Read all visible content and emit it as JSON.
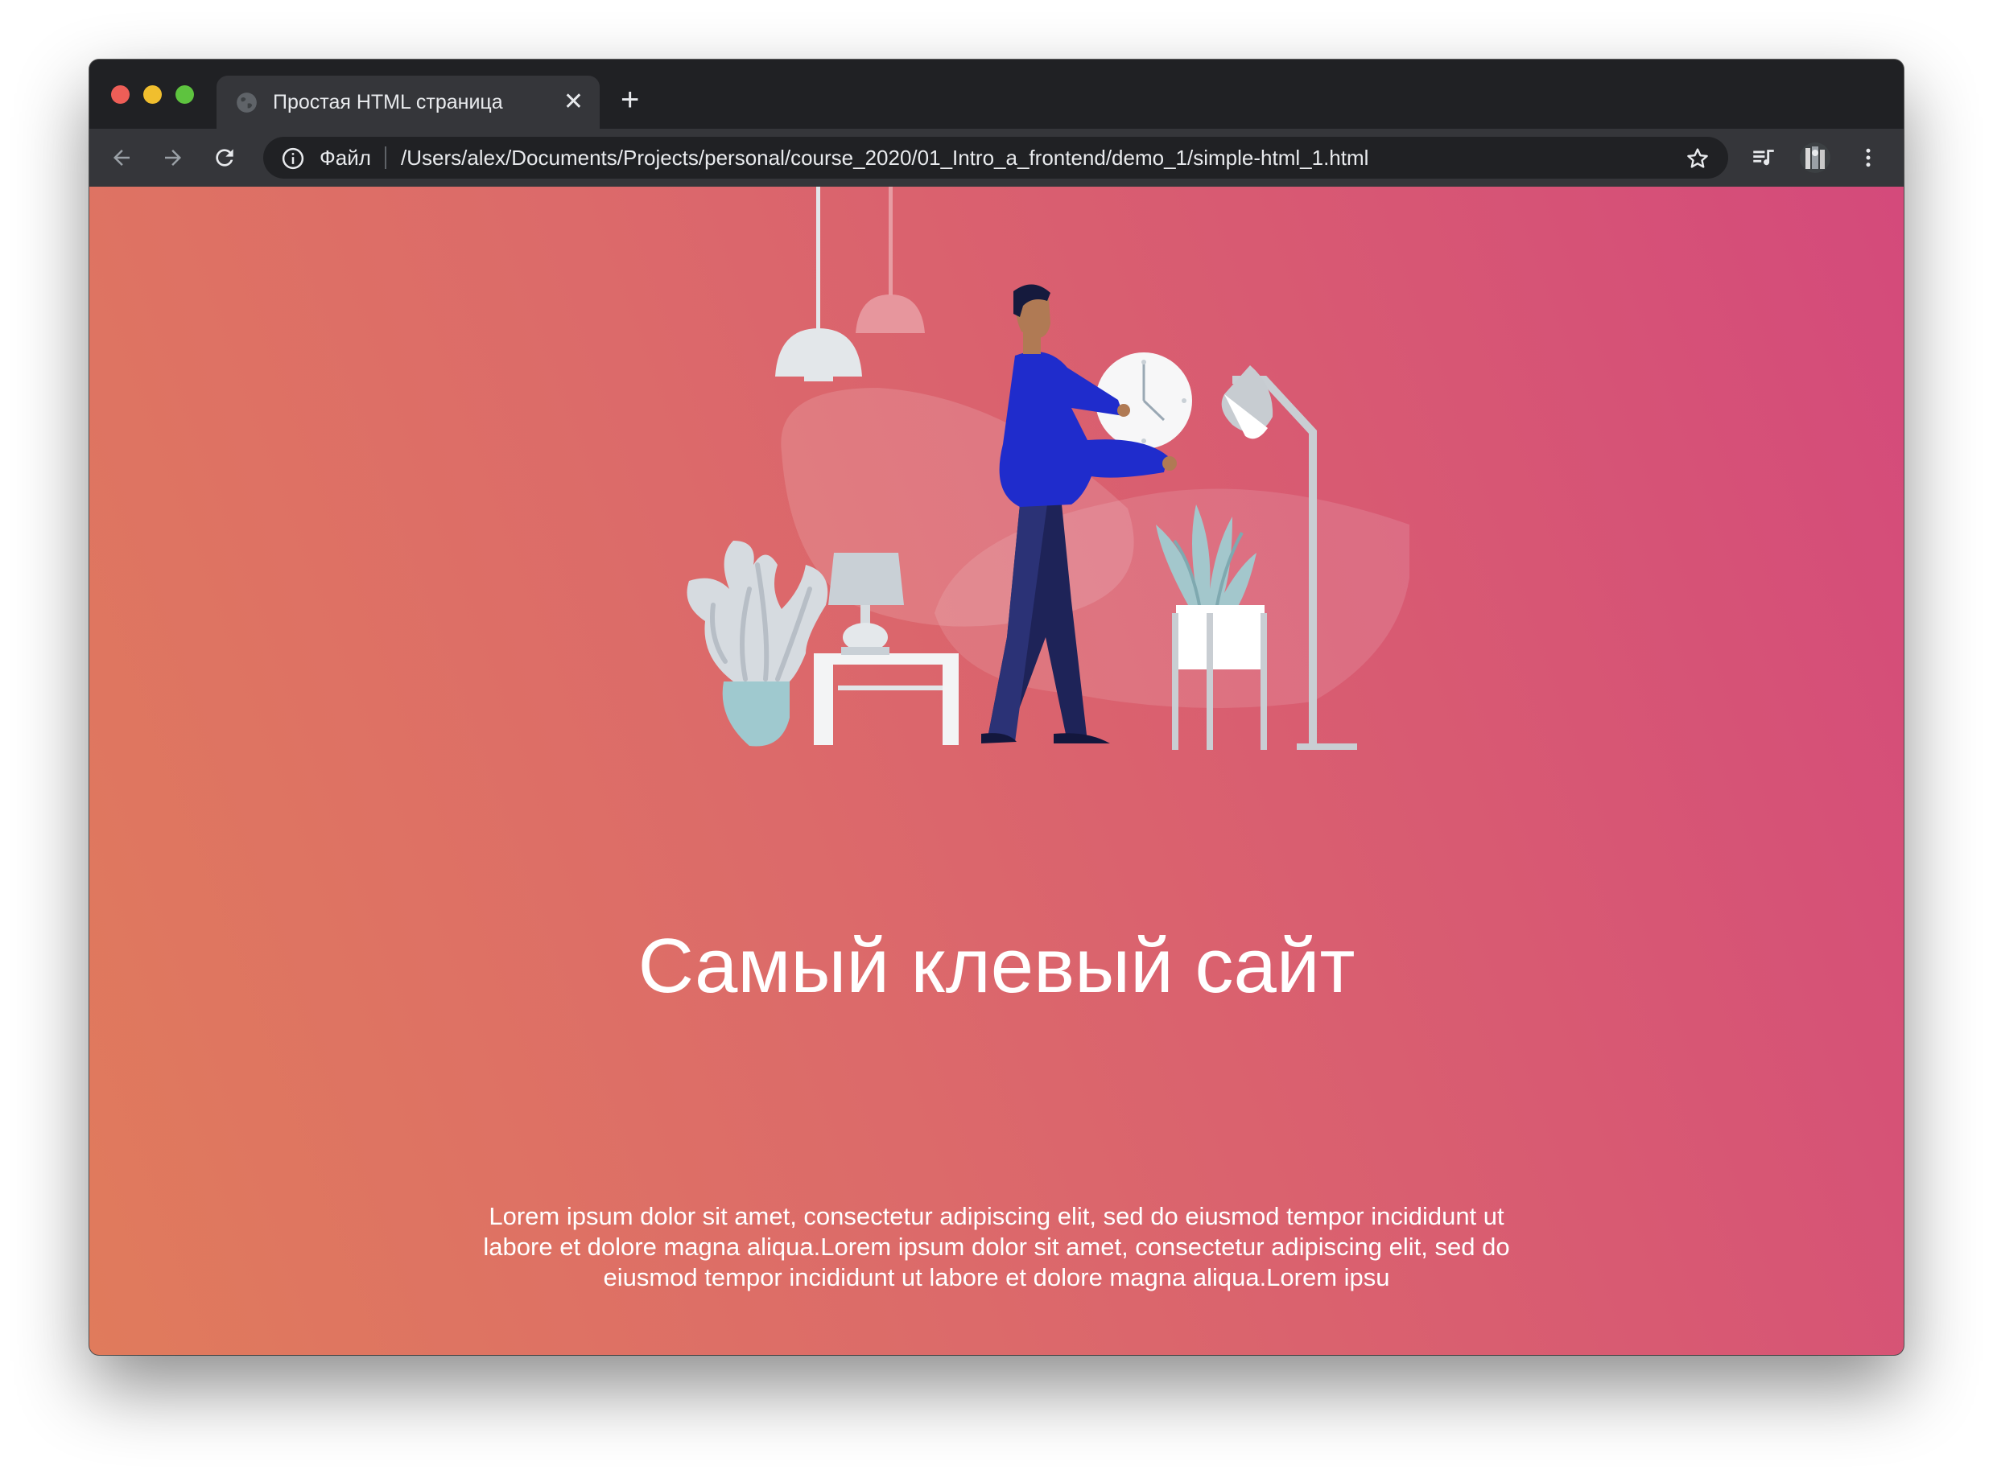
{
  "browser": {
    "tab_title": "Простая HTML страница",
    "tab_close": "✕",
    "new_tab": "+",
    "scheme_label": "Файл",
    "url": "/Users/alex/Documents/Projects/personal/course_2020/01_Intro_a_frontend/demo_1/simple-html_1.html",
    "icons": {
      "back": "arrow-back-icon",
      "forward": "arrow-forward-icon",
      "reload": "reload-icon",
      "info": "info-icon",
      "bookmark": "star-icon",
      "media": "media-queue-icon",
      "profile": "profile-avatar-icon",
      "menu": "kebab-menu-icon"
    },
    "colors": {
      "chrome_dark": "#202124",
      "chrome_toolbar": "#35363a",
      "close_red": "#ee5e57",
      "minimize_yellow": "#f0be2e",
      "maximize_green": "#5ec33f"
    }
  },
  "page": {
    "heading": "Самый клевый сайт",
    "paragraph": "Lorem ipsum dolor sit amet, consectetur adipiscing elit, sed do eiusmod tempor incididunt ut labore et dolore magna aliqua.Lorem ipsum dolor sit amet, consectetur adipiscing elit, sed do eiusmod tempor incididunt ut labore et dolore magna aliqua.Lorem ipsu",
    "gradient": [
      "#e07b5c",
      "#dc6a6a",
      "#d85a72",
      "#d44a7b"
    ]
  }
}
